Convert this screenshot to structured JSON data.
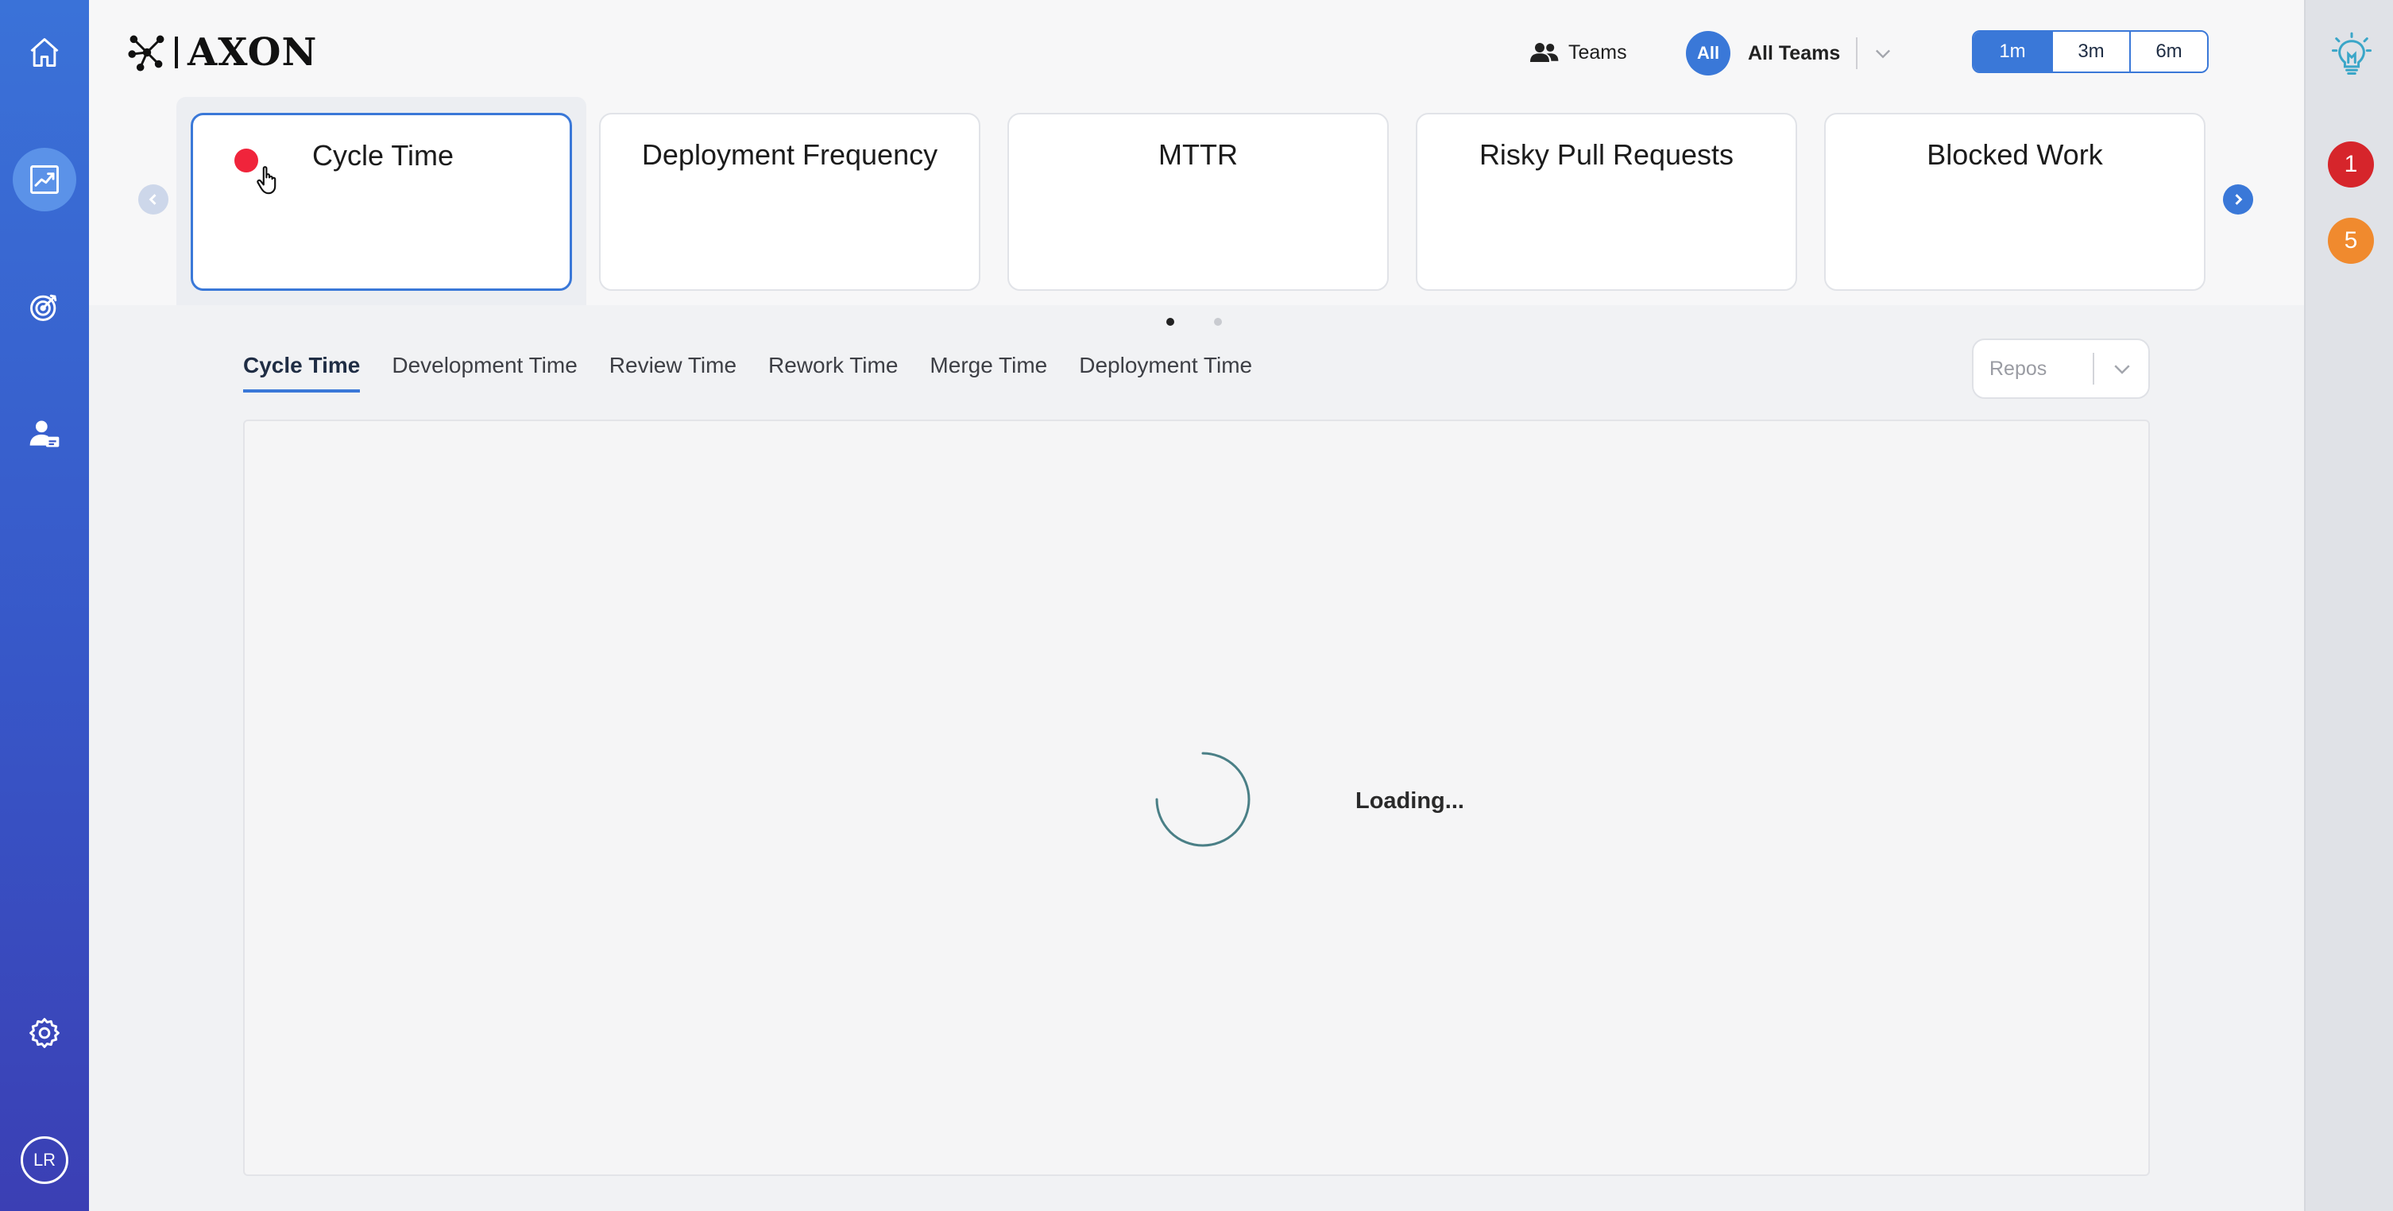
{
  "sidebar": {
    "nav": [
      {
        "name": "home-icon",
        "active": false
      },
      {
        "name": "trend-chart-icon",
        "active": true
      },
      {
        "name": "target-icon",
        "active": false
      },
      {
        "name": "user-card-icon",
        "active": false
      }
    ],
    "settings_icon": "gear-icon",
    "avatar_initials": "LR"
  },
  "header": {
    "logo_text": "AXON",
    "teams_label": "Teams",
    "team_badge": "All",
    "team_selected": "All Teams",
    "ranges": [
      {
        "label": "1m",
        "active": true
      },
      {
        "label": "3m",
        "active": false
      },
      {
        "label": "6m",
        "active": false
      }
    ]
  },
  "metric_cards": [
    {
      "title": "Cycle Time",
      "active": true
    },
    {
      "title": "Deployment Frequency",
      "active": false
    },
    {
      "title": "MTTR",
      "active": false
    },
    {
      "title": "Risky Pull Requests",
      "active": false
    },
    {
      "title": "Blocked Work",
      "active": false
    }
  ],
  "carousel": {
    "pages": 2,
    "current": 1
  },
  "tabs": [
    {
      "label": "Cycle Time",
      "active": true
    },
    {
      "label": "Development Time",
      "active": false
    },
    {
      "label": "Review Time",
      "active": false
    },
    {
      "label": "Rework Time",
      "active": false
    },
    {
      "label": "Merge Time",
      "active": false
    },
    {
      "label": "Deployment Time",
      "active": false
    }
  ],
  "repos_placeholder": "Repos",
  "loading_text": "Loading...",
  "rail": {
    "badges": [
      {
        "value": "1",
        "color": "#d6252b"
      },
      {
        "value": "5",
        "color": "#f08a2e"
      }
    ]
  },
  "colors": {
    "accent": "#3a78d8",
    "sidebar_top": "#3a72d8",
    "sidebar_bottom": "#3b3fb4",
    "alert_dot": "#f0243b"
  }
}
